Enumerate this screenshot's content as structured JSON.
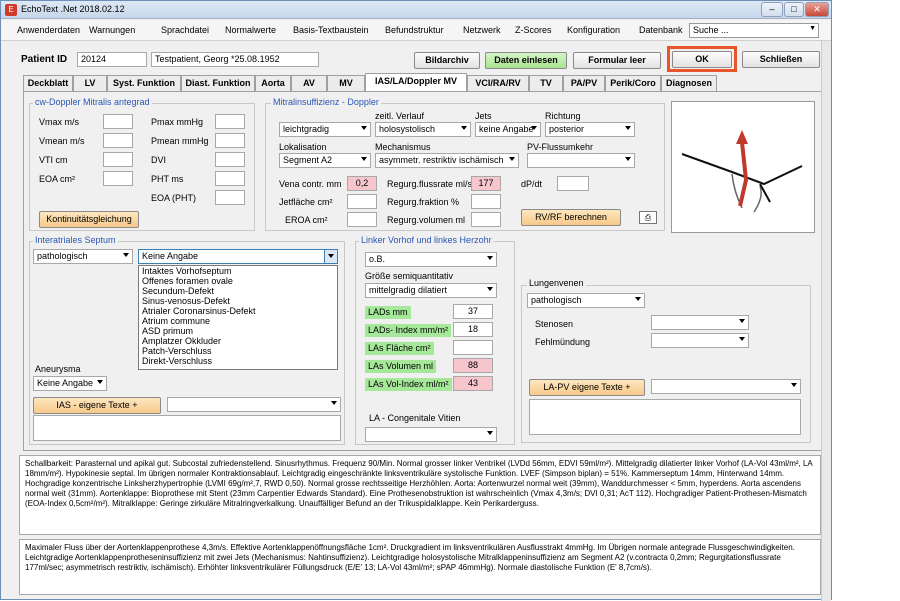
{
  "window": {
    "title": "EchoText .Net 2018.02.12",
    "minimize": "–",
    "maximize": "□",
    "close": "✕"
  },
  "menu": [
    "Anwenderdaten",
    "Warnungen",
    "Sprachdatei",
    "Normalwerte",
    "Basis-Textbaustein",
    "Befundstruktur",
    "Netzwerk",
    "Z-Scores",
    "Konfiguration",
    "Datenbank"
  ],
  "search": {
    "value": "Suche ..."
  },
  "patient": {
    "label": "Patient ID",
    "id": "20124",
    "name": "Testpatient, Georg *25.08.1952"
  },
  "buttons": {
    "bildarchiv": "Bildarchiv",
    "daten_einlesen": "Daten einlesen",
    "formular_leer": "Formular leer",
    "ok": "OK",
    "schliessen": "Schließen"
  },
  "tabs": [
    "Deckblatt",
    "LV",
    "Syst. Funktion",
    "Diast. Funktion",
    "Aorta",
    "AV",
    "MV",
    "IAS/LA/Doppler MV",
    "VCI/RA/RV",
    "TV",
    "PA/PV",
    "Perik/Coro",
    "Diagnosen"
  ],
  "cw_doppler": {
    "title": "cw-Doppler Mitralis antegrad",
    "labels_left": [
      "Vmax m/s",
      "Vmean m/s",
      "VTI cm",
      "EOA cm²"
    ],
    "labels_right": [
      "Pmax mmHg",
      "Pmean mmHg",
      "DVI",
      "PHT ms",
      "EOA (PHT)"
    ],
    "button": "Kontinuitätsgleichung"
  },
  "mitral": {
    "title": "Mitralinsuffizienz - Doppler",
    "zeitl_label": "zeitl. Verlauf",
    "jets_label": "Jets",
    "richtung_label": "Richtung",
    "severity": "leichtgradig",
    "zeitl": "holosystolisch",
    "jets": "keine Angabe",
    "richtung": "posterior",
    "lokalisation_label": "Lokalisation",
    "mechanismus_label": "Mechanismus",
    "pv_label": "PV-Flussumkehr",
    "lokalisation": "Segment A2",
    "mechanismus": "asymmetr. restriktiv ischämisch",
    "pv": "",
    "vena_label": "Vena contr. mm",
    "vena": "0,2",
    "regflow_label": "Regurg.flussrate ml/s",
    "regflow": "177",
    "dpdt_label": "dP/dt",
    "jetflaeche_label": "Jetfläche cm²",
    "regfrak_label": "Regurg.fraktion %",
    "eroa_label": "EROA cm²",
    "regvol_label": "Regurg.volumen ml",
    "button": "RV/RF berechnen"
  },
  "septum": {
    "title": "Interatriales Septum",
    "value": "pathologisch",
    "combo": "Keine Angabe",
    "options": [
      "Intaktes Vorhofseptum",
      "Offenes foramen ovale",
      "Secundum-Defekt",
      "Sinus-venosus-Defekt",
      "Atrialer Coronarsinus-Defekt",
      "Atrium commune",
      "ASD primum",
      "Amplatzer Okkluder",
      "Patch-Verschluss",
      "Direkt-Verschluss"
    ],
    "aneurysma_label": "Aneurysma",
    "aneurysma": "Keine Angabe",
    "button": "IAS - eigene Texte +"
  },
  "la": {
    "title": "Linker Vorhof und linkes Herzohr",
    "value": "o.B.",
    "size_label": "Größe semiquantitativ",
    "size": "mittelgradig dilatiert",
    "rows": [
      {
        "label": "LADs mm",
        "value": "37",
        "pink": false
      },
      {
        "label": "LADs- Index mm/m²",
        "value": "18",
        "pink": false
      },
      {
        "label": "LAs Fläche cm²",
        "value": "",
        "pink": false
      },
      {
        "label": "LAs Volumen ml",
        "value": "88",
        "pink": true
      },
      {
        "label": "LAs Vol-Index ml/m²",
        "value": "43",
        "pink": true
      }
    ],
    "congenital_label": "LA - Congenitale Vitien"
  },
  "lungenvenen": {
    "title": "Lungenvenen",
    "value": "pathologisch",
    "stenosen_label": "Stenosen",
    "fehlmuendung_label": "Fehlmündung",
    "button": "LA-PV eigene Texte +"
  },
  "report1": "Schallbarkeit: Parasternal und apikal gut. Subcostal zufriedenstellend. Sinusrhythmus. Frequenz 90/Min. Normal grosser linker Ventrikel (LVDd 56mm, EDVI 59ml/m²). Mittelgradig dilatierter linker Vorhof (LA-Vol 43ml/m², LA 18mm/m²). Hypokinesie septal. Im übrigen normaler Kontraktionsablauf. Leichtgradig eingeschränkte linksventrikuläre systolische Funktion. LVEF (Simpson biplan) = 51%. Kammerseptum 14mm, Hinterwand 14mm. Hochgradige konzentrische Linksherzhypertrophie (LVMI 69g/m²,7, RWD 0,50). Normal grosse rechtsseitige Herzhöhlen. Aorta: Aortenwurzel normal weit (39mm), Wanddurchmesser < 5mm, hyperdens. Aorta ascendens normal weit (31mm). Aortenklappe: Bioprothese mit Stent (23mm Carpentier Edwards Standard). Eine Prothesenobstruktion ist wahrscheinlich (Vmax 4,3m/s; DVI 0,31; AcT 112). Hochgradiger Patient-Prothesen-Mismatch (EOA-Index 0,5cm²/m²). Mitralklappe: Geringe zirkuläre Mitralringverkalkung. Unauffälliger Befund an der Trikuspidalklappe. Kein Perikarderguss.",
  "report2": "Maximaler Fluss über der Aortenklappenprothese 4,3m/s. Effektive Aortenklappenöffnungsfläche 1cm². Druckgradient im linksventrikulären Ausflusstrakt 4mmHg. Im Übrigen normale antegrade Flussgeschwindigkeiten. Leichtgradige Aortenklappenprotheseninsuffizienz mit zwei Jets (Mechanismus: Nahtinsuffizienz). Leichtgradige holosystolische Mitralklappeninsuffizienz am Segment A2 (v.contracta 0,2mm; Regurgitationsflussrate 177ml/sec; asymmetrisch restriktiv, ischämisch). Erhöhter linksventrikulärer Füllungsdruck (E/E' 13; LA-Vol 43ml/m²; sPAP 46mmHg). Normale diastolische Funktion (E' 8,7cm/s)."
}
